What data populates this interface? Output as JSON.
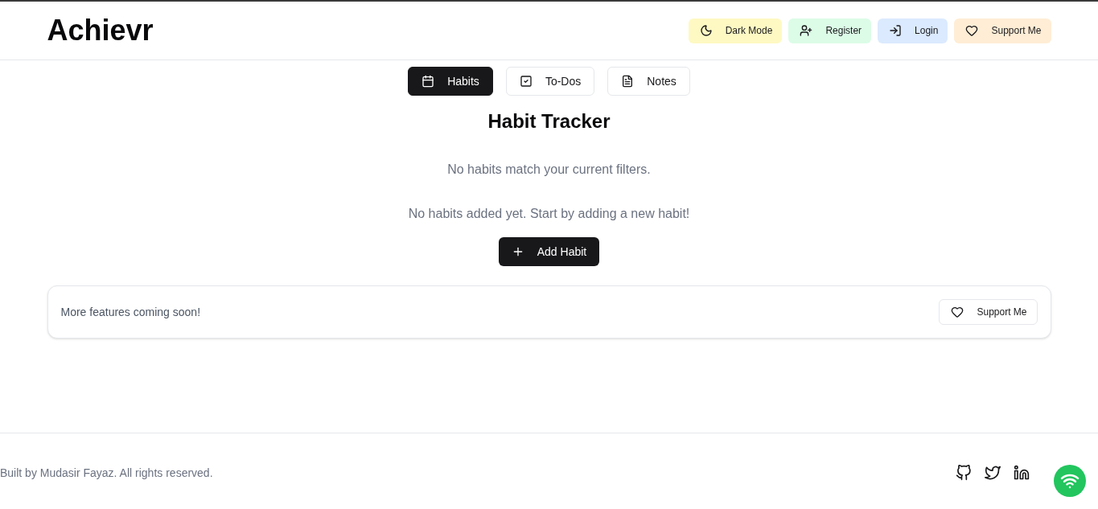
{
  "header": {
    "logo": "Achievr",
    "buttons": [
      {
        "kind": "theme",
        "label": "Dark Mode",
        "color": "#fef9c3"
      },
      {
        "kind": "register",
        "label": "Register",
        "color": "#dcfce7"
      },
      {
        "kind": "login",
        "label": "Login",
        "color": "#dbeafe"
      },
      {
        "kind": "support",
        "label": "Support Me",
        "color": "#ffedd5"
      }
    ]
  },
  "tabs": [
    {
      "kind": "habits",
      "label": "Habits",
      "selected": true
    },
    {
      "kind": "todos",
      "label": "To-Dos",
      "selected": false
    },
    {
      "kind": "notes",
      "label": "Notes",
      "selected": false
    }
  ],
  "main": {
    "title": "Habit Tracker",
    "messages": [
      "No habits match your current filters.",
      "No habits added yet. Start by adding a new habit!"
    ],
    "add_button": "Add Habit"
  },
  "notice": {
    "text": "More features coming soon!",
    "button": "Support Me"
  },
  "footer": {
    "copyright": "Built by Mudasir Fayaz. All rights reserved.",
    "links": [
      {
        "kind": "github"
      },
      {
        "kind": "twitter"
      },
      {
        "kind": "linkedin"
      }
    ]
  }
}
